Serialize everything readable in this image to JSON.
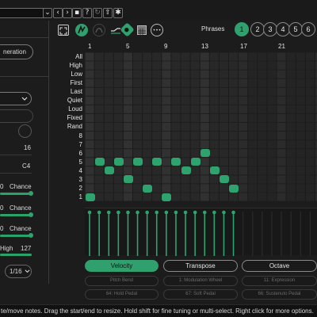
{
  "top": {
    "icons": [
      "chevron-down-icon",
      "chevron-left-icon",
      "chevron-right-icon",
      "save-icon",
      "help-icon",
      "refresh-icon",
      "share-icon",
      "gear-icon"
    ],
    "glyphs": [
      "⌄",
      "‹",
      "›",
      "▪",
      "?",
      "↻",
      "⇧",
      "✱"
    ]
  },
  "left": {
    "generate_label": "neration",
    "value_16": "16",
    "value_c4": "C4",
    "chance1_num": "0",
    "chance1_label": "Chance",
    "chance2_num": "0",
    "chance2_label": "Chance",
    "chance3_num": "0",
    "chance3_label": "Chance",
    "high_label": "High",
    "high_value": "127",
    "rate_value": "1/16"
  },
  "toolbar": {
    "phrases_label": "Phrases",
    "phrases": [
      "1",
      "2",
      "3",
      "4",
      "5",
      "6"
    ],
    "active_phrase": 0,
    "more_glyph": "•••"
  },
  "grid": {
    "row_labels": [
      "All",
      "High",
      "Low",
      "First",
      "Last",
      "Quiet",
      "Loud",
      "Fixed",
      "Rand",
      "8",
      "7",
      "6",
      "5",
      "4",
      "3",
      "2",
      "1"
    ],
    "col_numbers": [
      "1",
      "5",
      "9",
      "13",
      "17",
      "21"
    ],
    "notes": [
      {
        "step": 1,
        "pitch": 1
      },
      {
        "step": 2,
        "pitch": 5
      },
      {
        "step": 3,
        "pitch": 4
      },
      {
        "step": 4,
        "pitch": 5
      },
      {
        "step": 5,
        "pitch": 3
      },
      {
        "step": 6,
        "pitch": 5
      },
      {
        "step": 7,
        "pitch": 2
      },
      {
        "step": 8,
        "pitch": 5
      },
      {
        "step": 9,
        "pitch": 1
      },
      {
        "step": 10,
        "pitch": 5
      },
      {
        "step": 11,
        "pitch": 4
      },
      {
        "step": 12,
        "pitch": 5
      },
      {
        "step": 13,
        "pitch": 6
      },
      {
        "step": 14,
        "pitch": 4
      },
      {
        "step": 15,
        "pitch": 3
      },
      {
        "step": 16,
        "pitch": 2
      }
    ],
    "velocities": [
      1,
      1,
      1,
      1,
      1,
      1,
      1,
      1,
      1,
      1,
      1,
      1,
      1,
      1,
      1,
      1
    ]
  },
  "tabs": {
    "items": [
      "Velocity",
      "Transpose",
      "Octave"
    ],
    "active": 0,
    "cc": [
      "Pitch Bend",
      "1: Modulation Wheel",
      "11: Expression",
      "64: Hold Pedal",
      "67: Soft Pedal",
      "66: Sustenuto Pedal"
    ]
  },
  "status": {
    "text": "te/move notes. Drag the start/end to resize. Hold shift for fine tuning or multi-select. Right click for more options."
  },
  "colors": {
    "accent": "#2fa36d",
    "background": "#1c1c1c"
  }
}
